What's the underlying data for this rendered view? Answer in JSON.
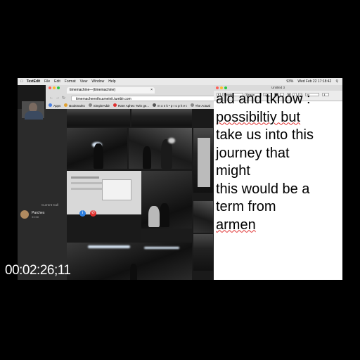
{
  "menubar": {
    "app": "TextEdit",
    "items": [
      "File",
      "Edit",
      "Format",
      "View",
      "Window",
      "Help"
    ],
    "clock": "Wed Feb 22  17:18:42",
    "battery": "93%"
  },
  "browser": {
    "tab_title": "timemachine—(timemachine)",
    "url": "timemacheenthcameinit.tumblr.com",
    "bookmarks": [
      "Apps",
      "Bookmarks",
      "SimpleAddr",
      "Rare Aphex Twin ge...",
      "m o n k • p r o p h e t",
      "The Actual"
    ]
  },
  "call": {
    "section_label": "Current Call",
    "caller_name": "Parches",
    "duration": "33:58"
  },
  "textedit": {
    "title": "Untitled 3",
    "font_name": "Helvetica",
    "style": "Regular",
    "size": "12",
    "lines": [
      "ald and tknow :",
      "possibiltiy but",
      "take us into this",
      "journey that",
      "might",
      "this would be a",
      "term from",
      "armen"
    ]
  },
  "timecode": "00:02:26;11",
  "colors": {
    "accent_blue": "#2d7fe0",
    "hangup_red": "#e0302d",
    "spell_underline": "#e03030"
  }
}
